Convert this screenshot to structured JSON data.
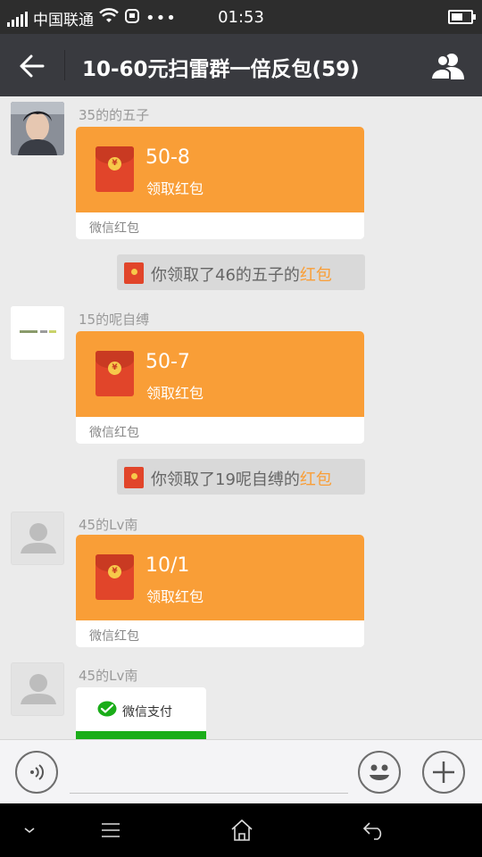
{
  "status_bar": {
    "carrier": "中国联通",
    "time": "01:53",
    "more": "•••",
    "battery_level": 0.6,
    "icons": [
      "signal-icon",
      "wifi-icon",
      "notification-icon",
      "battery-icon"
    ]
  },
  "header": {
    "title": "10-60元扫雷群一倍反包(59)",
    "icons": [
      "back-arrow-icon",
      "group-members-icon"
    ]
  },
  "colors": {
    "header_bg": "#393a3f",
    "chat_bg": "#ebebeb",
    "red_packet": "#f99e37",
    "link": "#f99e37",
    "wechat_green": "#1aad19"
  },
  "messages": [
    {
      "sender": "35的的五子",
      "avatar": "photo-avatar",
      "red_packet": {
        "amount": "50-8",
        "action": "领取红包",
        "footer": "微信红包"
      }
    },
    {
      "notice": {
        "text": "你领取了46的五子的",
        "link": "红包"
      }
    },
    {
      "sender": "15的呢自缚",
      "avatar": "white-logo-avatar",
      "red_packet": {
        "amount": "50-7",
        "action": "领取红包",
        "footer": "微信红包"
      }
    },
    {
      "notice": {
        "text": "你领取了19呢自缚的",
        "link": "红包"
      }
    },
    {
      "sender": "45的Lv南",
      "avatar": "default-avatar",
      "red_packet": {
        "amount": "10/1",
        "action": "领取红包",
        "footer": "微信红包"
      }
    },
    {
      "sender": "45的Lv南",
      "avatar": "default-avatar",
      "pay_card": {
        "label": "微信支付"
      }
    }
  ],
  "input_bar": {
    "icons": [
      "voice-icon",
      "emoji-icon",
      "plus-icon"
    ],
    "value": ""
  },
  "nav_bar": {
    "icons": [
      "chevron-down-icon",
      "menu-icon",
      "home-icon",
      "back-icon"
    ]
  }
}
